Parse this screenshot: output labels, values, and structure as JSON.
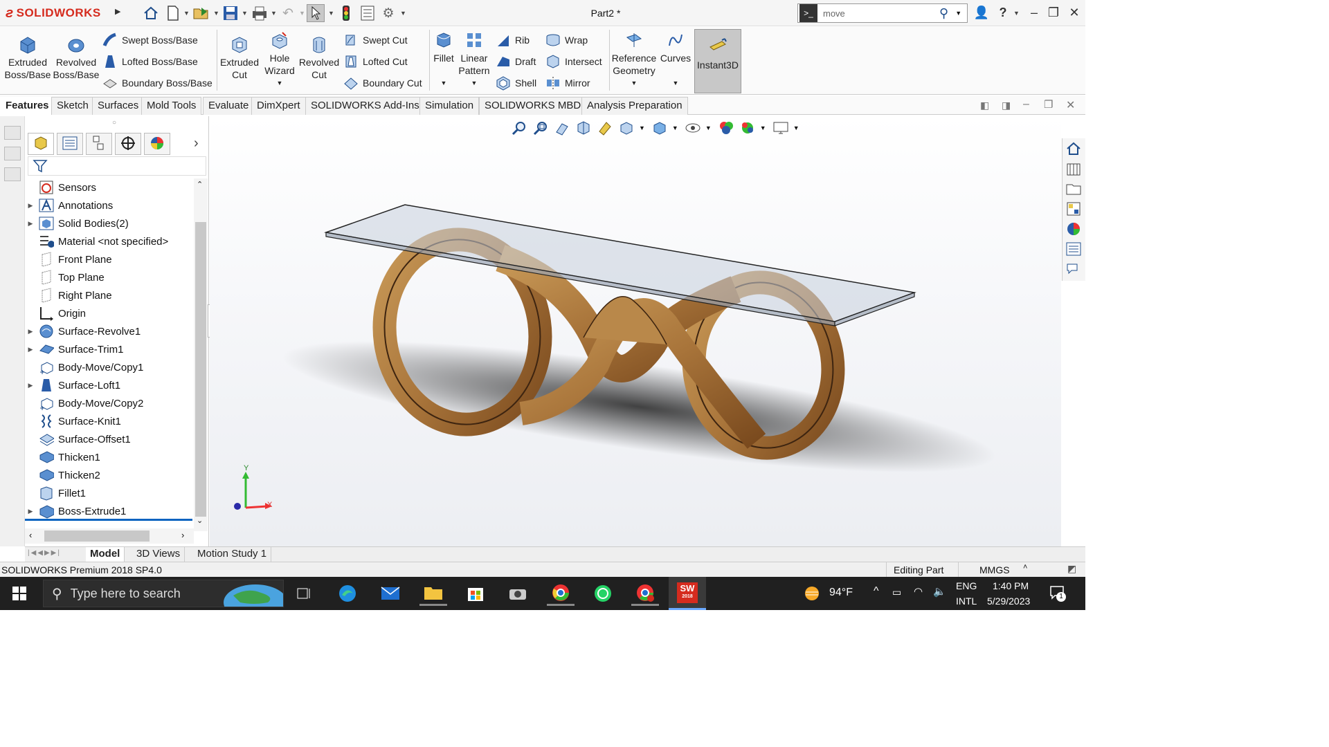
{
  "app": {
    "brand": "SOLIDWORKS",
    "title": "Part2 *",
    "accent": "#d52b1e"
  },
  "search": {
    "value": "move"
  },
  "ribbon": {
    "extruded_boss": "Extruded Boss/Base",
    "revolved_boss": "Revolved Boss/Base",
    "swept_boss": "Swept Boss/Base",
    "lofted_boss": "Lofted Boss/Base",
    "boundary_boss": "Boundary Boss/Base",
    "extruded_cut": "Extruded Cut",
    "hole_wizard": "Hole Wizard",
    "revolved_cut": "Revolved Cut",
    "swept_cut": "Swept Cut",
    "lofted_cut": "Lofted Cut",
    "boundary_cut": "Boundary Cut",
    "fillet": "Fillet",
    "linear_pattern": "Linear Pattern",
    "rib": "Rib",
    "draft": "Draft",
    "shell": "Shell",
    "wrap": "Wrap",
    "intersect": "Intersect",
    "mirror": "Mirror",
    "reference_geometry": "Reference Geometry",
    "curves": "Curves",
    "instant3d": "Instant3D"
  },
  "command_tabs": [
    "Features",
    "Sketch",
    "Surfaces",
    "Mold Tools",
    "Evaluate",
    "DimXpert",
    "SOLIDWORKS Add-Ins",
    "Simulation",
    "SOLIDWORKS MBD",
    "Analysis Preparation"
  ],
  "tree": [
    {
      "label": "Sensors",
      "icon": "sensor-icon",
      "expandable": false
    },
    {
      "label": "Annotations",
      "icon": "annotations-icon",
      "expandable": true
    },
    {
      "label": "Solid Bodies(2)",
      "icon": "solid-bodies-icon",
      "expandable": true
    },
    {
      "label": "Material <not specified>",
      "icon": "material-icon",
      "expandable": false
    },
    {
      "label": "Front Plane",
      "icon": "plane-icon",
      "expandable": false
    },
    {
      "label": "Top Plane",
      "icon": "plane-icon",
      "expandable": false
    },
    {
      "label": "Right Plane",
      "icon": "plane-icon",
      "expandable": false
    },
    {
      "label": "Origin",
      "icon": "origin-icon",
      "expandable": false
    },
    {
      "label": "Surface-Revolve1",
      "icon": "surface-revolve-icon",
      "expandable": true
    },
    {
      "label": "Surface-Trim1",
      "icon": "surface-trim-icon",
      "expandable": true
    },
    {
      "label": "Body-Move/Copy1",
      "icon": "move-copy-icon",
      "expandable": false
    },
    {
      "label": "Surface-Loft1",
      "icon": "surface-loft-icon",
      "expandable": true
    },
    {
      "label": "Body-Move/Copy2",
      "icon": "move-copy-icon",
      "expandable": false
    },
    {
      "label": "Surface-Knit1",
      "icon": "surface-knit-icon",
      "expandable": false
    },
    {
      "label": "Surface-Offset1",
      "icon": "surface-offset-icon",
      "expandable": false
    },
    {
      "label": "Thicken1",
      "icon": "thicken-icon",
      "expandable": false
    },
    {
      "label": "Thicken2",
      "icon": "thicken-icon",
      "expandable": false
    },
    {
      "label": "Fillet1",
      "icon": "fillet-icon",
      "expandable": false
    },
    {
      "label": "Boss-Extrude1",
      "icon": "boss-extrude-icon",
      "expandable": true
    }
  ],
  "bottom_tabs": [
    "Model",
    "3D Views",
    "Motion Study 1"
  ],
  "status": {
    "version": "SOLIDWORKS Premium 2018 SP4.0",
    "mode": "Editing Part",
    "units": "MMGS"
  },
  "triad": {
    "x": "X",
    "y": "Y"
  },
  "taskbar": {
    "search_placeholder": "Type here to search",
    "temperature": "94°F",
    "lang1": "ENG",
    "lang2": "INTL",
    "time": "1:40 PM",
    "date": "5/29/2023",
    "notifications": "1",
    "sw_badge": "SW",
    "sw_year": "2018"
  }
}
